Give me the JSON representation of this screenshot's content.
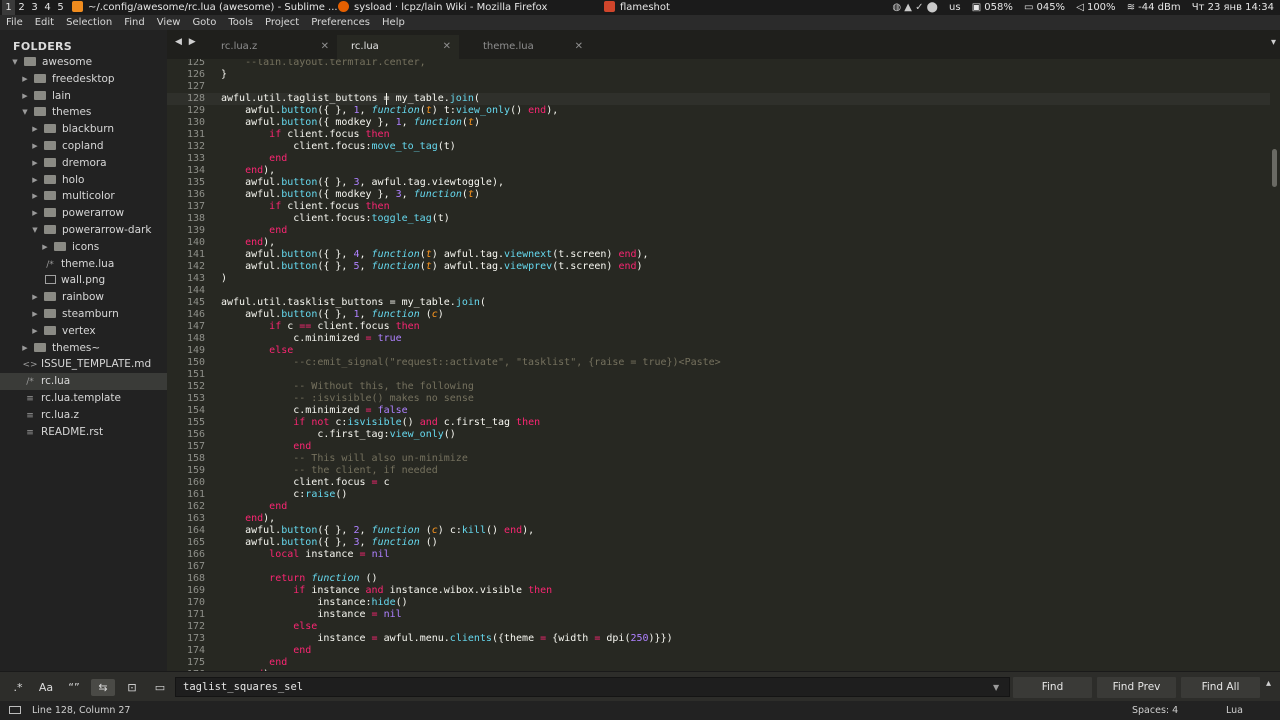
{
  "topbar": {
    "tags": [
      "1",
      "2",
      "3",
      "4",
      "5"
    ],
    "tasks": [
      {
        "title": "~/.config/awesome/rc.lua (awesome) - Sublime ...",
        "icon": "sublime-icon",
        "color": "#f08c1e"
      },
      {
        "title": "sysload · lcpz/lain Wiki - Mozilla Firefox",
        "icon": "firefox-icon",
        "color": "#e66000"
      },
      {
        "title": "flameshot",
        "icon": "flameshot-icon",
        "color": "#d0452b"
      }
    ],
    "layout": "us",
    "cpu": "058%",
    "battery": "045%",
    "volume": "100%",
    "wifi": "-44 dBm",
    "datetime": "Чт 23 янв 14:34"
  },
  "menubar": [
    "File",
    "Edit",
    "Selection",
    "Find",
    "View",
    "Goto",
    "Tools",
    "Project",
    "Preferences",
    "Help"
  ],
  "sidebar": {
    "header": "FOLDERS",
    "items": [
      {
        "label": "awesome",
        "type": "folder",
        "open": true,
        "level": 0
      },
      {
        "label": "freedesktop",
        "type": "folder",
        "open": false,
        "level": 1
      },
      {
        "label": "lain",
        "type": "folder",
        "open": false,
        "level": 1
      },
      {
        "label": "themes",
        "type": "folder",
        "open": true,
        "level": 1
      },
      {
        "label": "blackburn",
        "type": "folder",
        "open": false,
        "level": 2
      },
      {
        "label": "copland",
        "type": "folder",
        "open": false,
        "level": 2
      },
      {
        "label": "dremora",
        "type": "folder",
        "open": false,
        "level": 2
      },
      {
        "label": "holo",
        "type": "folder",
        "open": false,
        "level": 2
      },
      {
        "label": "multicolor",
        "type": "folder",
        "open": false,
        "level": 2
      },
      {
        "label": "powerarrow",
        "type": "folder",
        "open": false,
        "level": 2
      },
      {
        "label": "powerarrow-dark",
        "type": "folder",
        "open": true,
        "level": 2
      },
      {
        "label": "icons",
        "type": "folder",
        "open": false,
        "level": 3
      },
      {
        "label": "theme.lua",
        "type": "file",
        "icon": "/*",
        "level": 3
      },
      {
        "label": "wall.png",
        "type": "image",
        "level": 3
      },
      {
        "label": "rainbow",
        "type": "folder",
        "open": false,
        "level": 2
      },
      {
        "label": "steamburn",
        "type": "folder",
        "open": false,
        "level": 2
      },
      {
        "label": "vertex",
        "type": "folder",
        "open": false,
        "level": 2
      },
      {
        "label": "themes~",
        "type": "folder",
        "open": false,
        "level": 1
      },
      {
        "label": "ISSUE_TEMPLATE.md",
        "type": "file",
        "icon": "<>",
        "level": 1
      },
      {
        "label": "rc.lua",
        "type": "file",
        "icon": "/*",
        "level": 1,
        "selected": true
      },
      {
        "label": "rc.lua.template",
        "type": "file",
        "icon": "≡",
        "level": 1
      },
      {
        "label": "rc.lua.z",
        "type": "file",
        "icon": "≡",
        "level": 1
      },
      {
        "label": "README.rst",
        "type": "file",
        "icon": "≡",
        "level": 1
      }
    ]
  },
  "tabs": [
    {
      "label": "rc.lua.z",
      "active": false
    },
    {
      "label": "rc.lua",
      "active": true
    },
    {
      "label": "theme.lua",
      "active": false
    }
  ],
  "editor": {
    "first_line": 125,
    "lines": [
      [
        [
          "c",
          "    --lain.layout.termfair.center,"
        ]
      ],
      [
        [
          "",
          "}"
        ]
      ],
      [
        [
          "",
          ""
        ]
      ],
      [
        [
          "",
          "awful.util.taglist_buttons = my_table."
        ],
        [
          "b",
          "join"
        ],
        [
          "",
          "("
        ]
      ],
      [
        [
          "",
          "    awful."
        ],
        [
          "b",
          "button"
        ],
        [
          "",
          "({ }, "
        ],
        [
          "n",
          "1"
        ],
        [
          "",
          ", "
        ],
        [
          "f",
          "function"
        ],
        [
          "",
          "("
        ],
        [
          "p",
          "t"
        ],
        [
          "",
          ") t:"
        ],
        [
          "b",
          "view_only"
        ],
        [
          "",
          "() "
        ],
        [
          "k",
          "end"
        ],
        [
          "",
          "),"
        ]
      ],
      [
        [
          "",
          "    awful."
        ],
        [
          "b",
          "button"
        ],
        [
          "",
          "({ modkey }, "
        ],
        [
          "n",
          "1"
        ],
        [
          "",
          ", "
        ],
        [
          "f",
          "function"
        ],
        [
          "",
          "("
        ],
        [
          "p",
          "t"
        ],
        [
          "",
          ")"
        ]
      ],
      [
        [
          "",
          "        "
        ],
        [
          "k",
          "if"
        ],
        [
          "",
          " client.focus "
        ],
        [
          "k",
          "then"
        ]
      ],
      [
        [
          "",
          "            client.focus:"
        ],
        [
          "b",
          "move_to_tag"
        ],
        [
          "",
          "(t)"
        ]
      ],
      [
        [
          "",
          "        "
        ],
        [
          "k",
          "end"
        ]
      ],
      [
        [
          "",
          "    "
        ],
        [
          "k",
          "end"
        ],
        [
          "",
          "),"
        ]
      ],
      [
        [
          "",
          "    awful."
        ],
        [
          "b",
          "button"
        ],
        [
          "",
          "({ }, "
        ],
        [
          "n",
          "3"
        ],
        [
          "",
          ", awful.tag.viewtoggle),"
        ]
      ],
      [
        [
          "",
          "    awful."
        ],
        [
          "b",
          "button"
        ],
        [
          "",
          "({ modkey }, "
        ],
        [
          "n",
          "3"
        ],
        [
          "",
          ", "
        ],
        [
          "f",
          "function"
        ],
        [
          "",
          "("
        ],
        [
          "p",
          "t"
        ],
        [
          "",
          ")"
        ]
      ],
      [
        [
          "",
          "        "
        ],
        [
          "k",
          "if"
        ],
        [
          "",
          " client.focus "
        ],
        [
          "k",
          "then"
        ]
      ],
      [
        [
          "",
          "            client.focus:"
        ],
        [
          "b",
          "toggle_tag"
        ],
        [
          "",
          "(t)"
        ]
      ],
      [
        [
          "",
          "        "
        ],
        [
          "k",
          "end"
        ]
      ],
      [
        [
          "",
          "    "
        ],
        [
          "k",
          "end"
        ],
        [
          "",
          "),"
        ]
      ],
      [
        [
          "",
          "    awful."
        ],
        [
          "b",
          "button"
        ],
        [
          "",
          "({ }, "
        ],
        [
          "n",
          "4"
        ],
        [
          "",
          ", "
        ],
        [
          "f",
          "function"
        ],
        [
          "",
          "("
        ],
        [
          "p",
          "t"
        ],
        [
          "",
          ") awful.tag."
        ],
        [
          "b",
          "viewnext"
        ],
        [
          "",
          "(t.screen) "
        ],
        [
          "k",
          "end"
        ],
        [
          "",
          "),"
        ]
      ],
      [
        [
          "",
          "    awful."
        ],
        [
          "b",
          "button"
        ],
        [
          "",
          "({ }, "
        ],
        [
          "n",
          "5"
        ],
        [
          "",
          ", "
        ],
        [
          "f",
          "function"
        ],
        [
          "",
          "("
        ],
        [
          "p",
          "t"
        ],
        [
          "",
          ") awful.tag."
        ],
        [
          "b",
          "viewprev"
        ],
        [
          "",
          "(t.screen) "
        ],
        [
          "k",
          "end"
        ],
        [
          "",
          ")"
        ]
      ],
      [
        [
          "",
          ")"
        ]
      ],
      [
        [
          "",
          ""
        ]
      ],
      [
        [
          "",
          "awful.util.tasklist_buttons = my_table."
        ],
        [
          "b",
          "join"
        ],
        [
          "",
          "("
        ]
      ],
      [
        [
          "",
          "    awful."
        ],
        [
          "b",
          "button"
        ],
        [
          "",
          "({ }, "
        ],
        [
          "n",
          "1"
        ],
        [
          "",
          ", "
        ],
        [
          "f",
          "function"
        ],
        [
          "",
          " ("
        ],
        [
          "p",
          "c"
        ],
        [
          "",
          ")"
        ]
      ],
      [
        [
          "",
          "        "
        ],
        [
          "k",
          "if"
        ],
        [
          "",
          " c "
        ],
        [
          "k",
          "=="
        ],
        [
          "",
          " client.focus "
        ],
        [
          "k",
          "then"
        ]
      ],
      [
        [
          "",
          "            c.minimized "
        ],
        [
          "k",
          "="
        ],
        [
          "",
          " "
        ],
        [
          "n",
          "true"
        ]
      ],
      [
        [
          "",
          "        "
        ],
        [
          "k",
          "else"
        ]
      ],
      [
        [
          "c",
          "            --c:emit_signal(\"request::activate\", \"tasklist\", {raise = true})<Paste>"
        ]
      ],
      [
        [
          "",
          ""
        ]
      ],
      [
        [
          "c",
          "            -- Without this, the following"
        ]
      ],
      [
        [
          "c",
          "            -- :isvisible() makes no sense"
        ]
      ],
      [
        [
          "",
          "            c.minimized "
        ],
        [
          "k",
          "="
        ],
        [
          "",
          " "
        ],
        [
          "n",
          "false"
        ]
      ],
      [
        [
          "",
          "            "
        ],
        [
          "k",
          "if"
        ],
        [
          "",
          " "
        ],
        [
          "k",
          "not"
        ],
        [
          "",
          " c:"
        ],
        [
          "b",
          "isvisible"
        ],
        [
          "",
          "() "
        ],
        [
          "k",
          "and"
        ],
        [
          "",
          " c.first_tag "
        ],
        [
          "k",
          "then"
        ]
      ],
      [
        [
          "",
          "                c.first_tag:"
        ],
        [
          "b",
          "view_only"
        ],
        [
          "",
          "()"
        ]
      ],
      [
        [
          "",
          "            "
        ],
        [
          "k",
          "end"
        ]
      ],
      [
        [
          "c",
          "            -- This will also un-minimize"
        ]
      ],
      [
        [
          "c",
          "            -- the client, if needed"
        ]
      ],
      [
        [
          "",
          "            client.focus "
        ],
        [
          "k",
          "="
        ],
        [
          "",
          " c"
        ]
      ],
      [
        [
          "",
          "            c:"
        ],
        [
          "b",
          "raise"
        ],
        [
          "",
          "()"
        ]
      ],
      [
        [
          "",
          "        "
        ],
        [
          "k",
          "end"
        ]
      ],
      [
        [
          "",
          "    "
        ],
        [
          "k",
          "end"
        ],
        [
          "",
          "),"
        ]
      ],
      [
        [
          "",
          "    awful."
        ],
        [
          "b",
          "button"
        ],
        [
          "",
          "({ }, "
        ],
        [
          "n",
          "2"
        ],
        [
          "",
          ", "
        ],
        [
          "f",
          "function"
        ],
        [
          "",
          " ("
        ],
        [
          "p",
          "c"
        ],
        [
          "",
          ") c:"
        ],
        [
          "b",
          "kill"
        ],
        [
          "",
          "() "
        ],
        [
          "k",
          "end"
        ],
        [
          "",
          "),"
        ]
      ],
      [
        [
          "",
          "    awful."
        ],
        [
          "b",
          "button"
        ],
        [
          "",
          "({ }, "
        ],
        [
          "n",
          "3"
        ],
        [
          "",
          ", "
        ],
        [
          "f",
          "function"
        ],
        [
          "",
          " ()"
        ]
      ],
      [
        [
          "",
          "        "
        ],
        [
          "k",
          "local"
        ],
        [
          "",
          " instance "
        ],
        [
          "k",
          "="
        ],
        [
          "",
          " "
        ],
        [
          "n",
          "nil"
        ]
      ],
      [
        [
          "",
          ""
        ]
      ],
      [
        [
          "",
          "        "
        ],
        [
          "k",
          "return"
        ],
        [
          "",
          " "
        ],
        [
          "f",
          "function"
        ],
        [
          "",
          " ()"
        ]
      ],
      [
        [
          "",
          "            "
        ],
        [
          "k",
          "if"
        ],
        [
          "",
          " instance "
        ],
        [
          "k",
          "and"
        ],
        [
          "",
          " instance.wibox.visible "
        ],
        [
          "k",
          "then"
        ]
      ],
      [
        [
          "",
          "                instance:"
        ],
        [
          "b",
          "hide"
        ],
        [
          "",
          "()"
        ]
      ],
      [
        [
          "",
          "                instance "
        ],
        [
          "k",
          "="
        ],
        [
          "",
          " "
        ],
        [
          "n",
          "nil"
        ]
      ],
      [
        [
          "",
          "            "
        ],
        [
          "k",
          "else"
        ]
      ],
      [
        [
          "",
          "                instance "
        ],
        [
          "k",
          "="
        ],
        [
          "",
          " awful.menu."
        ],
        [
          "b",
          "clients"
        ],
        [
          "",
          "({theme "
        ],
        [
          "k",
          "="
        ],
        [
          "",
          " {width "
        ],
        [
          "k",
          "="
        ],
        [
          "",
          " dpi("
        ],
        [
          "n",
          "250"
        ],
        [
          "",
          ")}})"
        ]
      ],
      [
        [
          "",
          "            "
        ],
        [
          "k",
          "end"
        ]
      ],
      [
        [
          "",
          "        "
        ],
        [
          "k",
          "end"
        ]
      ],
      [
        [
          "",
          "    "
        ],
        [
          "k",
          "end"
        ],
        [
          "",
          "),"
        ]
      ]
    ]
  },
  "findpanel": {
    "options": [
      {
        "label": ".*",
        "name": "regex-toggle",
        "on": false
      },
      {
        "label": "Aa",
        "name": "case-toggle",
        "on": false
      },
      {
        "label": "“”",
        "name": "whole-word-toggle",
        "on": false
      },
      {
        "label": "⇆",
        "name": "wrap-toggle",
        "on": true
      },
      {
        "label": "⊡",
        "name": "in-selection-toggle",
        "on": false
      },
      {
        "label": "▭",
        "name": "highlight-toggle",
        "on": false
      }
    ],
    "query": "taglist_squares_sel",
    "find": "Find",
    "find_prev": "Find Prev",
    "find_all": "Find All"
  },
  "statusbar": {
    "position": "Line 128, Column 27",
    "spaces": "Spaces: 4",
    "syntax": "Lua"
  }
}
